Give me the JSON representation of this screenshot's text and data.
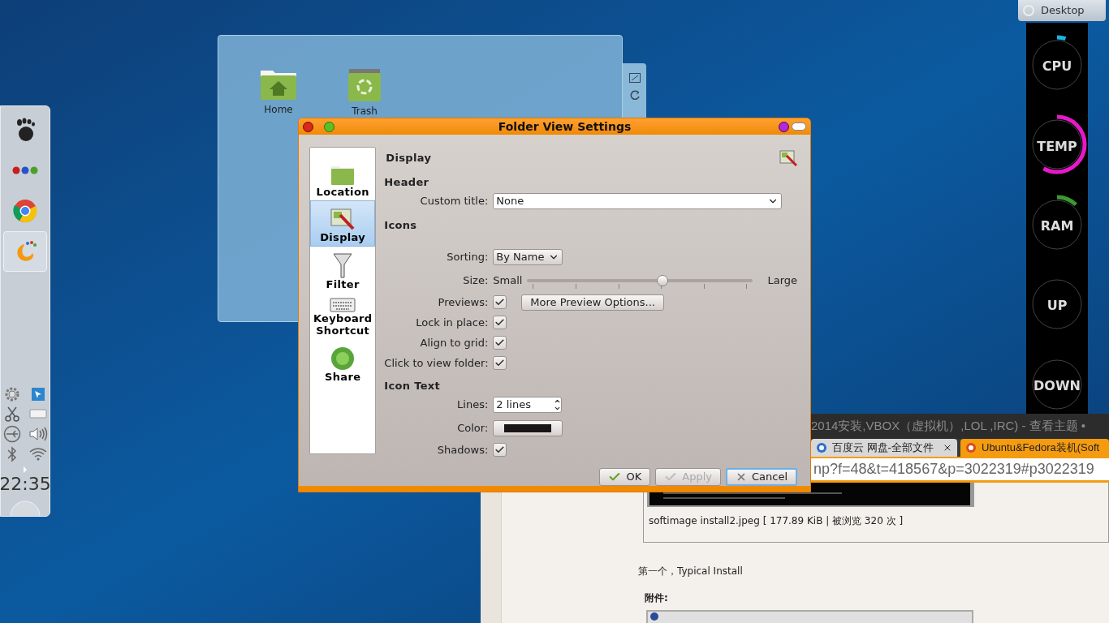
{
  "panel": {
    "launchers": [
      {
        "kind": "foot",
        "selected": false
      },
      {
        "kind": "dots",
        "selected": false
      },
      {
        "kind": "browser",
        "selected": false
      },
      {
        "kind": "swirl",
        "selected": true
      }
    ],
    "clock": "22:35"
  },
  "folder_view": {
    "items": [
      {
        "label": "Home",
        "kind": "home"
      },
      {
        "label": "Trash",
        "kind": "trash"
      }
    ]
  },
  "monitor": {
    "desktop_button": "Desktop",
    "gauges": [
      {
        "label": "CPU"
      },
      {
        "label": "TEMP"
      },
      {
        "label": "RAM"
      },
      {
        "label": "UP"
      },
      {
        "label": "DOWN"
      }
    ]
  },
  "browser": {
    "title": "2014安装,VBOX（虚拟机）,LOL ,IRC) - 查看主题 •",
    "tabs": [
      {
        "label": "百度云 网盘-全部文件",
        "selected": false
      },
      {
        "label": "Ubuntu&Fedora装机(Soft",
        "selected": true
      }
    ],
    "url": "np?f=48&t=418567&p=3022319#p3022319",
    "caption": "softimage install2.jpeg [ 177.89 KiB | 被浏览 320 次 ]",
    "paragraph": "第一个，Typical Install",
    "attachments_heading": "附件:"
  },
  "dialog": {
    "title": "Folder View Settings",
    "pages": [
      {
        "label": "Location",
        "kind": "folder",
        "selected": false
      },
      {
        "label": "Display",
        "kind": "display",
        "selected": true
      },
      {
        "label": "Filter",
        "kind": "funnel",
        "selected": false
      },
      {
        "label": "Keyboard Shortcut",
        "kind": "keyboard",
        "selected": false
      },
      {
        "label": "Share",
        "kind": "globe",
        "selected": false
      }
    ],
    "page_title": "Display",
    "sections": [
      {
        "heading": "Header",
        "rows": [
          {
            "kind": "editable-combo",
            "label": "Custom title:",
            "value": "None"
          }
        ]
      },
      {
        "heading": "Icons",
        "rows": [
          {
            "kind": "combo",
            "label": "Sorting:",
            "value": "By Name"
          },
          {
            "kind": "slider",
            "label": "Size:",
            "min_label": "Small",
            "max_label": "Large",
            "level": 0.6
          },
          {
            "kind": "check",
            "label": "Previews:",
            "checked": true,
            "button": "More Preview Options..."
          },
          {
            "kind": "check",
            "label": "Lock in place:",
            "checked": true
          },
          {
            "kind": "check",
            "label": "Align to grid:",
            "checked": true
          },
          {
            "kind": "check",
            "label": "Click to view folder:",
            "checked": true
          }
        ]
      },
      {
        "heading": "Icon Text",
        "rows": [
          {
            "kind": "spin",
            "label": "Lines:",
            "value": "2 lines"
          },
          {
            "kind": "color",
            "label": "Color:",
            "color": "#1a1616"
          },
          {
            "kind": "check",
            "label": "Shadows:",
            "checked": true
          }
        ]
      }
    ],
    "buttons": [
      {
        "kind": "ok",
        "label": "OK",
        "disabled": false,
        "focused": false
      },
      {
        "kind": "apply",
        "label": "Apply",
        "disabled": true,
        "focused": false
      },
      {
        "kind": "cancel",
        "label": "Cancel",
        "disabled": false,
        "focused": true
      }
    ]
  }
}
